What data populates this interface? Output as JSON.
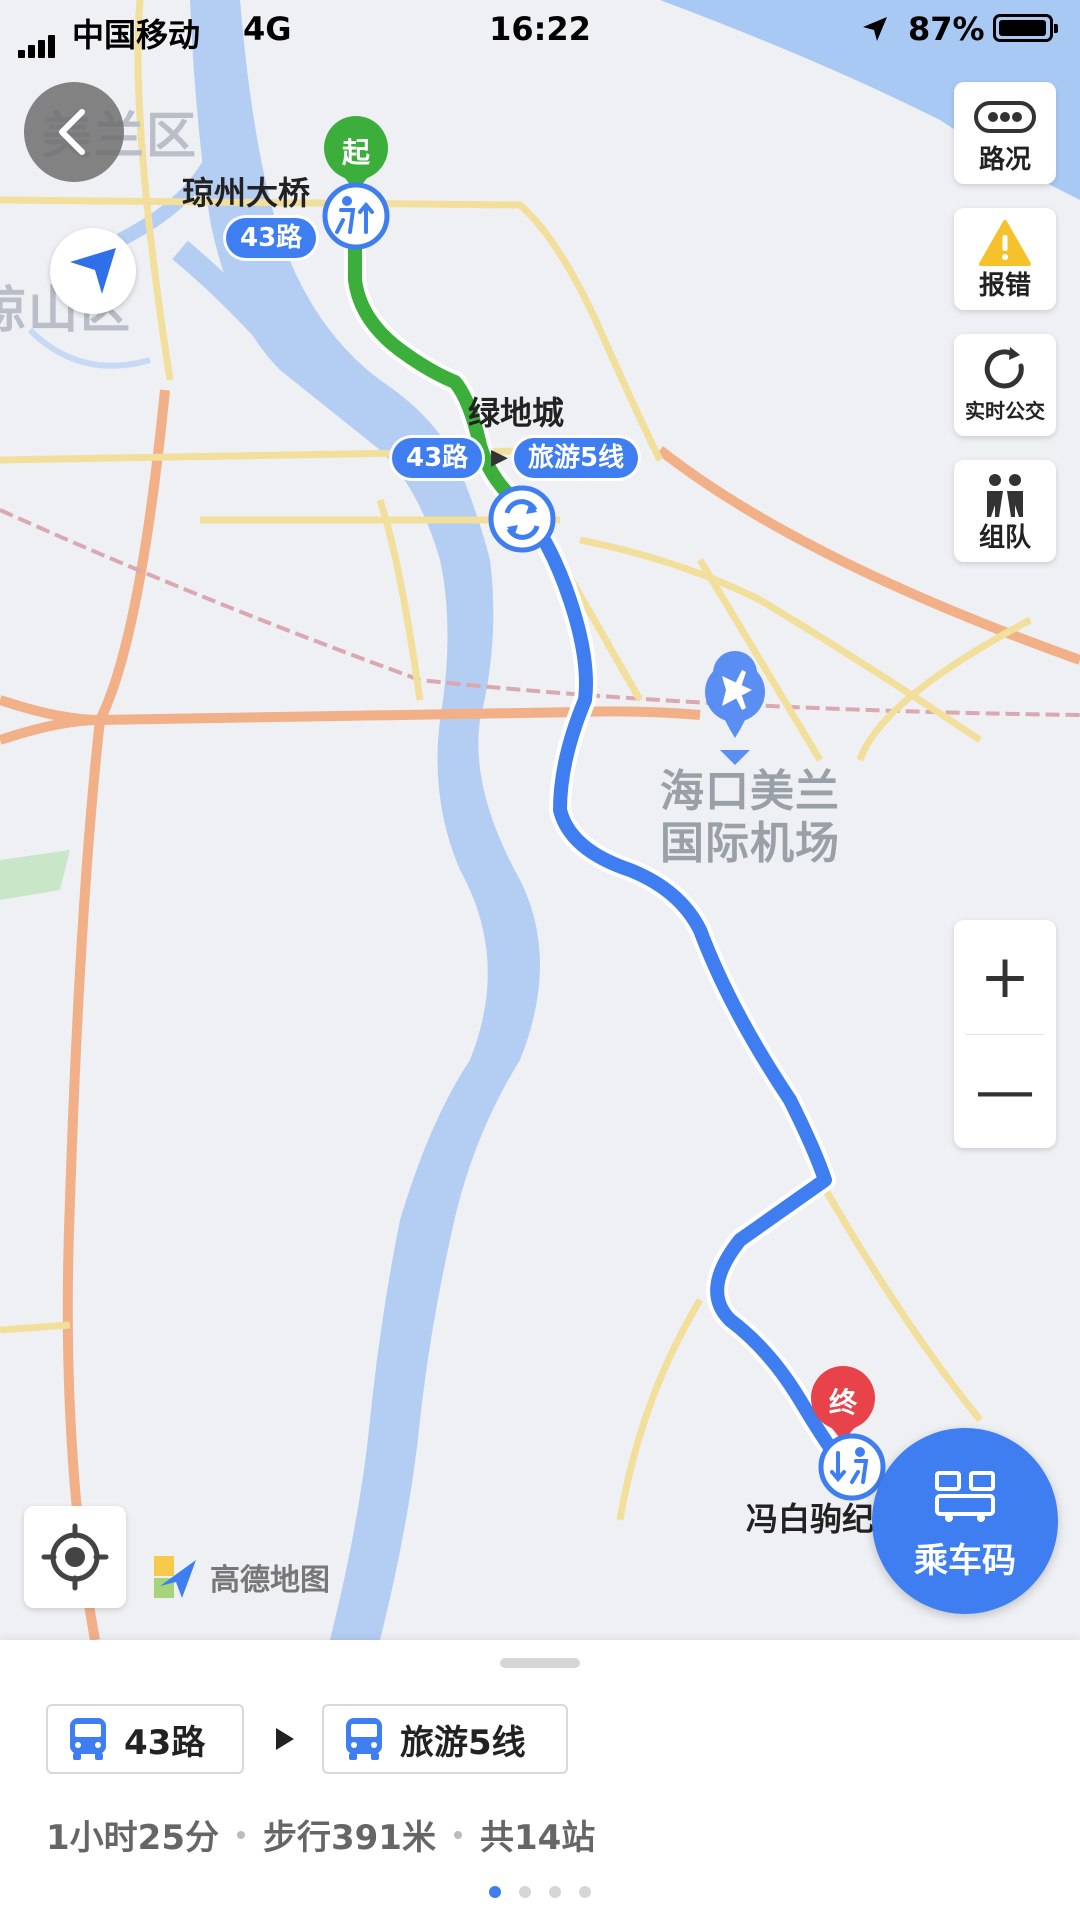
{
  "status_bar": {
    "carrier": "中国移动",
    "network": "4G",
    "time": "16:22",
    "battery_percent": "87%"
  },
  "map": {
    "districts": [
      "美兰区",
      "琼山区"
    ],
    "start_marker": "起",
    "end_marker": "终",
    "start_stop": "琼州大桥",
    "transfer_stop": "绿地城",
    "end_stop": "冯白驹纪",
    "first_line_tag": "43路",
    "transfer_tags": {
      "from": "43路",
      "to": "旅游5线"
    },
    "airport_name": "海口美兰国际机场",
    "airport_name_lines": [
      "海口美兰",
      "国际机场"
    ],
    "route_colors": {
      "first_leg": "#3cae3c",
      "second_leg": "#3f7ef0",
      "start_pin": "#3cae3c",
      "end_pin": "#e8424a"
    }
  },
  "controls": {
    "traffic_label": "路况",
    "report_label": "报错",
    "realtime_bus_label": "实时公交",
    "team_label": "组队",
    "zoom_in": "+",
    "zoom_out": "—",
    "ride_code_label": "乘车码",
    "map_logo_text": "高德地图"
  },
  "icons": {
    "back": "chevron-left-icon",
    "nav": "navigation-arrow-icon",
    "locate": "crosshair-icon",
    "traffic": "traffic-dots-icon",
    "report": "warning-icon",
    "realtime": "refresh-icon",
    "team": "people-icon",
    "bus": "bus-icon",
    "ride_code": "qr-bus-icon"
  },
  "route_summary": {
    "segments": [
      "43路",
      "旅游5线"
    ],
    "duration": "1小时25分",
    "walk": "步行391米",
    "stops": "共14站",
    "page_count": 4,
    "active_page": 1
  }
}
